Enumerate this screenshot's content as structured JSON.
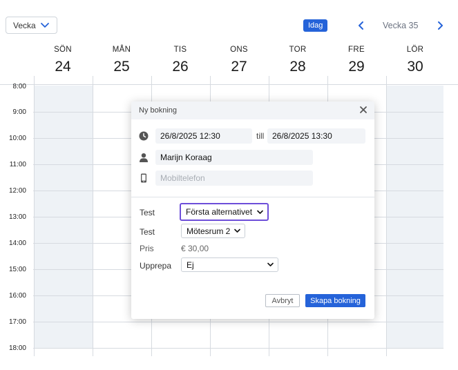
{
  "toolbar": {
    "view_select_label": "Vecka",
    "today_label": "Idag",
    "week_label": "Vecka 35"
  },
  "calendar": {
    "days": [
      {
        "name": "SÖN",
        "num": "24",
        "weekend": true
      },
      {
        "name": "MÅN",
        "num": "25",
        "weekend": false
      },
      {
        "name": "TIS",
        "num": "26",
        "weekend": false
      },
      {
        "name": "ONS",
        "num": "27",
        "weekend": false
      },
      {
        "name": "TOR",
        "num": "28",
        "weekend": false
      },
      {
        "name": "FRE",
        "num": "29",
        "weekend": false
      },
      {
        "name": "LÖR",
        "num": "30",
        "weekend": true
      }
    ],
    "times": [
      "8:00",
      "9:00",
      "10:00",
      "11:00",
      "12:00",
      "13:00",
      "14:00",
      "15:00",
      "16:00",
      "17:00",
      "18:00"
    ],
    "weekend_color": "#eef2f6"
  },
  "dialog": {
    "title": "Ny bokning",
    "start_value": "26/8/2025  12:30",
    "till_label": "till",
    "end_value": "26/8/2025  13:30",
    "name_value": "Marijn Koraag",
    "phone_placeholder": "Mobiltelefon",
    "rows": {
      "test1_label": "Test",
      "test1_value": "Första alternativet",
      "test2_label": "Test",
      "test2_value": "Mötesrum 2",
      "price_label": "Pris",
      "price_value": "€ 30,00",
      "repeat_label": "Upprepa",
      "repeat_value": "Ej"
    },
    "cancel_label": "Avbryt",
    "create_label": "Skapa bokning"
  },
  "colors": {
    "accent": "#2563d9",
    "focus": "#6d4ed9"
  }
}
